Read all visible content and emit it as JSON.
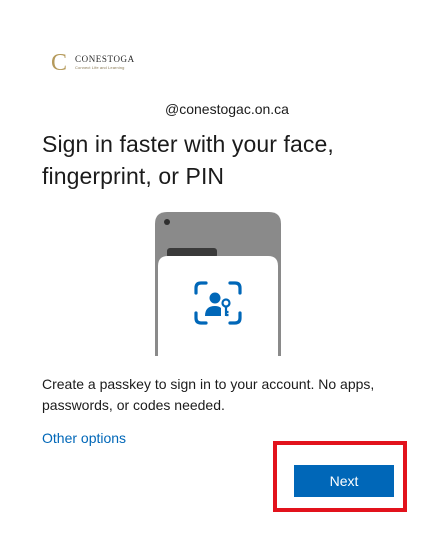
{
  "brand": {
    "logo_letter": "C",
    "name": "CONESTOGA",
    "tagline": "Connect Life and Learning",
    "colors": {
      "gold": "#b59a5b",
      "dark": "#2b2b2b"
    }
  },
  "account": {
    "email": "@conestogac.on.ca"
  },
  "heading": {
    "line1": "Sign in faster with your face,",
    "line2": "fingerprint, or PIN"
  },
  "illustration": {
    "icon": "passkey-face-scan-icon",
    "colors": {
      "phone_body": "#8a8a8a",
      "phone_notch": "#2f2f2f",
      "card": "#ffffff",
      "accent": "#0067b8"
    }
  },
  "description": "Create a passkey to sign in to your account. No apps, passwords, or codes needed.",
  "links": {
    "other_options": "Other options"
  },
  "actions": {
    "next": "Next"
  },
  "theme": {
    "primary": "#0067b8",
    "highlight": "#e2121c",
    "text": "#1b1b1b"
  }
}
